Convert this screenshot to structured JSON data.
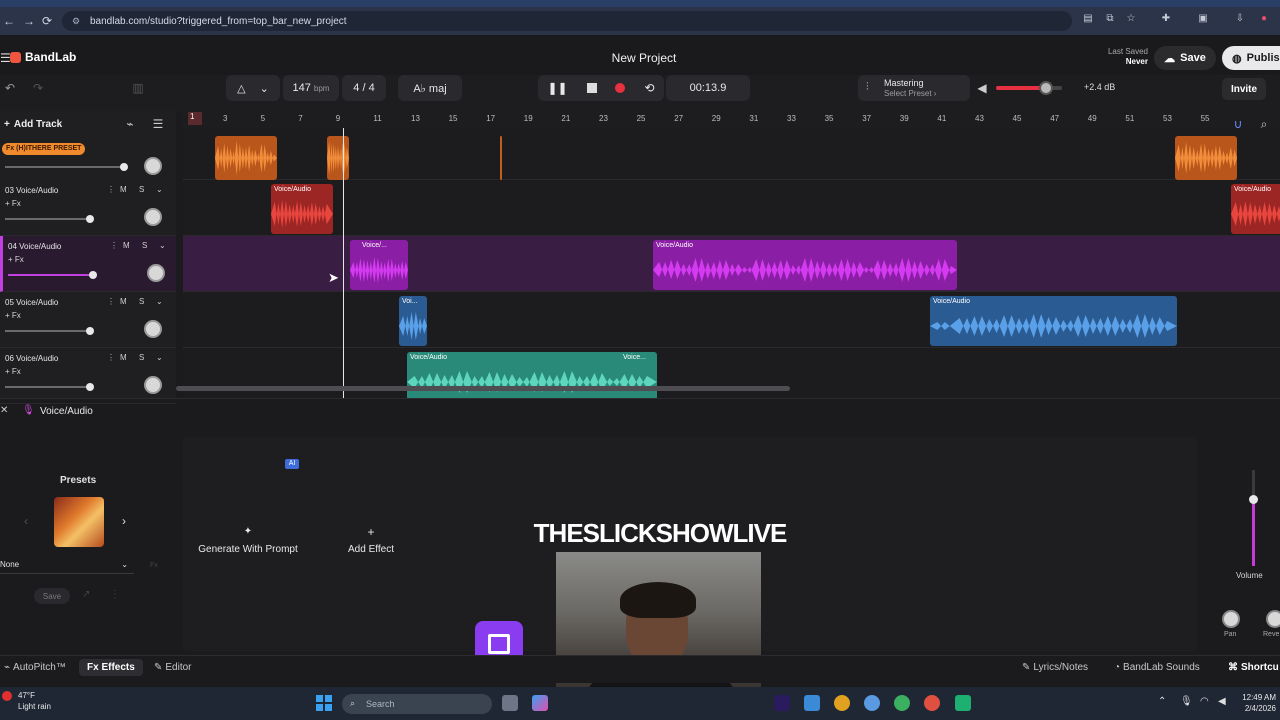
{
  "browser": {
    "url": "bandlab.com/studio?triggered_from=top_bar_new_project"
  },
  "app": {
    "logo": "BandLab",
    "project_title": "New Project",
    "last_saved_label": "Last Saved",
    "last_saved_value": "Never",
    "save_label": "Save",
    "publish_label": "Publis"
  },
  "transport": {
    "bpm": "147",
    "bpm_unit": "bpm",
    "time_signature": "4 / 4",
    "key": "A♭ maj",
    "time": "00:13.9",
    "mastering_title": "Mastering",
    "mastering_sub": "Select Preset ›",
    "master_db": "+2.4 dB",
    "invite_label": "Invite",
    "master_volume_fraction": 0.75
  },
  "tracks_panel": {
    "add_track_label": "Add Track",
    "preset_tag": "Fx (H)ITHERE PRESET",
    "ruler_ticks": [
      "1",
      "3",
      "5",
      "7",
      "9",
      "11",
      "13",
      "15",
      "17",
      "19",
      "21",
      "23",
      "25",
      "27",
      "29",
      "31",
      "33",
      "35",
      "37",
      "39",
      "41",
      "43",
      "45",
      "47",
      "49",
      "51",
      "53",
      "55"
    ],
    "tracks": [
      {
        "name": "03 Voice/Audio",
        "fx": "+ Fx",
        "mute": "M",
        "solo": "S"
      },
      {
        "name": "04 Voice/Audio",
        "fx": "+ Fx",
        "mute": "M",
        "solo": "S"
      },
      {
        "name": "05 Voice/Audio",
        "fx": "+ Fx",
        "mute": "M",
        "solo": "S"
      },
      {
        "name": "06 Voice/Audio",
        "fx": "+ Fx",
        "mute": "M",
        "solo": "S"
      }
    ],
    "clip_labels": {
      "track3_a": "Voice/Audio",
      "track3_b": "Voice/Audio",
      "track4_a": "Voice/...",
      "track4_b": "Voice/Audio",
      "track5_a": "Voi...",
      "track5_b": "Voice/Audio",
      "track6_a": "Voice/Audio",
      "track6_b": "Voice..."
    },
    "colors": {
      "orange": "#e8762c",
      "red": "#d83a36",
      "purple": "#b82ad6",
      "blue": "#3d7ec8",
      "teal": "#3db8a2"
    }
  },
  "bottom_panel": {
    "title": "Voice/Audio",
    "presets_label": "Presets",
    "preset_value": "None",
    "preset_save": "Save",
    "ai_badge": "AI",
    "generate_label": "Generate With Prompt",
    "add_effect_label": "Add Effect",
    "volume_label": "Volume",
    "pan_label": "Pan",
    "reverb_label": "Reve"
  },
  "overlay": {
    "stream_title": "THESLICKSHOWLIVE"
  },
  "tabs": {
    "autopitch": "AutoPitch™",
    "effects": "Fx Effects",
    "editor": "Editor",
    "lyrics": "Lyrics/Notes",
    "sounds": "BandLab Sounds",
    "shortcuts": "Shortcu"
  },
  "taskbar": {
    "temp": "47°F",
    "weather": "Light rain",
    "search_placeholder": "Search",
    "time": "12:49 AM",
    "date": "2/4/2026"
  }
}
